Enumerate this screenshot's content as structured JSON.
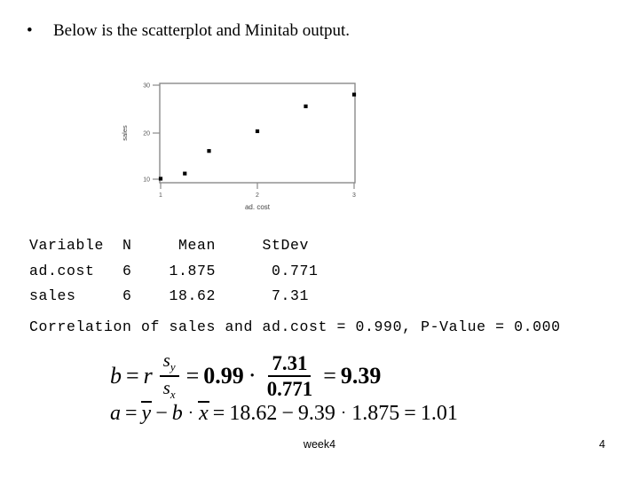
{
  "slide": {
    "bullet_glyph": "•",
    "bullet_text": "Below is the scatterplot and Minitab output."
  },
  "chart_data": {
    "type": "scatter",
    "title": "",
    "xlabel": "ad. cost",
    "ylabel": "sales",
    "xlim": [
      0.88,
      3.1
    ],
    "ylim": [
      9.0,
      30.6
    ],
    "xticks": [
      1,
      2,
      3
    ],
    "xticklabels": [
      "1",
      "2",
      "3"
    ],
    "yticks": [
      10,
      20,
      30
    ],
    "yticklabels": [
      "10",
      "20",
      "30"
    ],
    "grid": false,
    "legend": "none",
    "marker": "square",
    "marker_color": "#000000",
    "frame_color": "#808080",
    "x": [
      1.0,
      1.25,
      1.5,
      2.0,
      2.5,
      3.0
    ],
    "y": [
      10.1,
      11.2,
      16.0,
      20.2,
      25.5,
      28.0
    ],
    "points": [
      {
        "x": 1.0,
        "y": 10.1
      },
      {
        "x": 1.25,
        "y": 11.2
      },
      {
        "x": 1.5,
        "y": 16.0
      },
      {
        "x": 2.0,
        "y": 20.2
      },
      {
        "x": 2.5,
        "y": 25.5
      },
      {
        "x": 3.0,
        "y": 28.0
      }
    ]
  },
  "minitab": {
    "table_text": "Variable  N     Mean     StDev\nad.cost   6    1.875      0.771\nsales     6    18.62      7.31",
    "headers": [
      "Variable",
      "N",
      "Mean",
      "StDev"
    ],
    "rows": [
      {
        "variable": "ad.cost",
        "n": "6",
        "mean": "1.875",
        "stdev": "0.771"
      },
      {
        "variable": "sales",
        "n": "6",
        "mean": "18.62",
        "stdev": "7.31"
      }
    ],
    "correlation_line": "Correlation of sales and ad.cost = 0.990, P-Value = 0.000",
    "correlation_value": "0.990",
    "p_value": "0.000"
  },
  "equations": {
    "b": {
      "lhs": "b",
      "eq1": "=",
      "r": "r",
      "s_num": "s",
      "s_num_sub": "y",
      "s_den": "s",
      "s_den_sub": "x",
      "eq2": "=",
      "r_value": "0.99",
      "dot": "·",
      "frac_num": "7.31",
      "frac_den": "0.771",
      "eq3": "=",
      "result": "9.39"
    },
    "a": {
      "lhs": "a",
      "eq1": "=",
      "ybar": "y",
      "minus": "−",
      "b": "b",
      "dot": "·",
      "xbar": "x",
      "eq2": "=",
      "ymean": "18.62",
      "minus2": "−",
      "slope": "9.39",
      "dot2": "·",
      "xmean": "1.875",
      "eq3": "=",
      "result": "1.01"
    }
  },
  "footer": {
    "label": "week4",
    "page_number": "4"
  }
}
